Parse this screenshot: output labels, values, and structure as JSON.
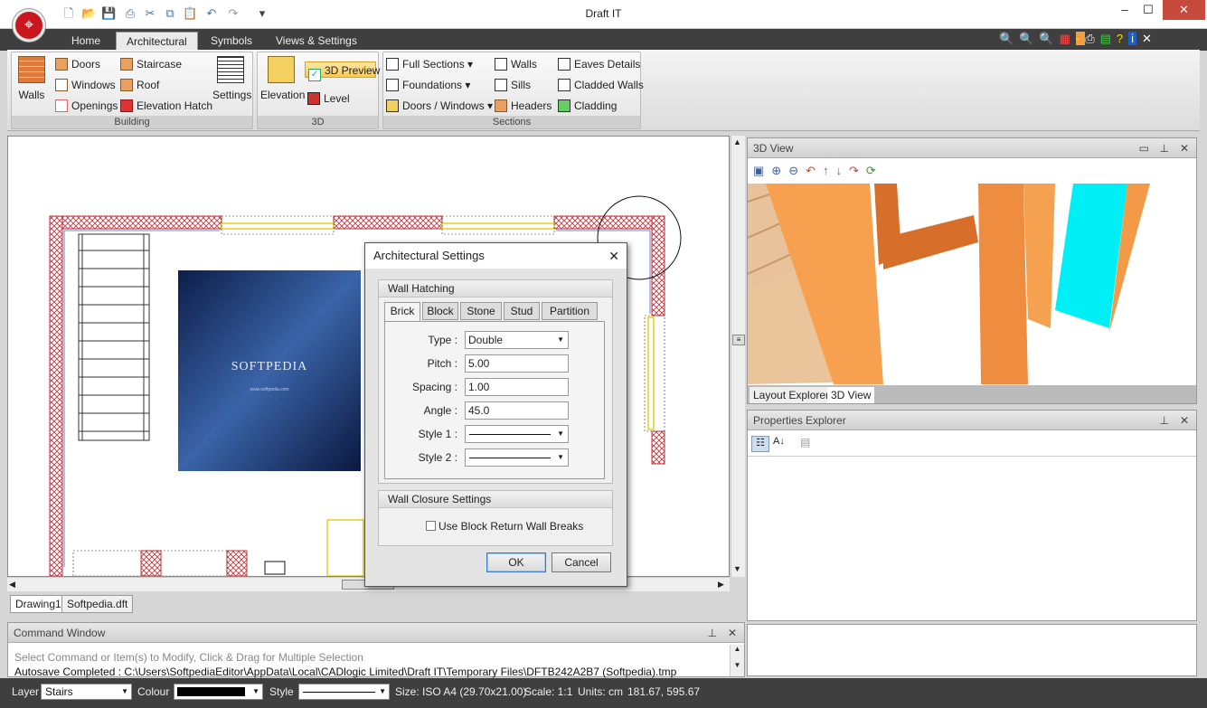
{
  "app": {
    "title": "Draft IT"
  },
  "ribbon_tabs": [
    "Home",
    "Architectural",
    "Symbols",
    "Views & Settings"
  ],
  "ribbon": {
    "building": {
      "caption": "Building",
      "walls": "Walls",
      "doors": "Doors",
      "windows": "Windows",
      "openings": "Openings",
      "staircase": "Staircase",
      "roof": "Roof",
      "elevation_hatch": "Elevation Hatch",
      "settings": "Settings"
    },
    "threed": {
      "caption": "3D",
      "elevation": "Elevation",
      "preview": "3D Preview",
      "level": "Level"
    },
    "sections": {
      "caption": "Sections",
      "full_sections": "Full Sections",
      "foundations": "Foundations",
      "doors_windows": "Doors / Windows",
      "walls": "Walls",
      "sills": "Sills",
      "headers": "Headers",
      "eaves": "Eaves Details",
      "cladded_walls": "Cladded Walls",
      "cladding": "Cladding"
    }
  },
  "canvas": {
    "watermark": "SOFTPEDIA",
    "watermark_url": "www.softpedia.com"
  },
  "doc_tabs": [
    "Drawing1",
    "Softpedia.dft"
  ],
  "command_window": {
    "title": "Command Window",
    "prompt": "Select Command or Item(s) to Modify, Click & Drag for Multiple Selection",
    "log": "Autosave Completed : C:\\Users\\SoftpediaEditor\\AppData\\Local\\CADlogic Limited\\Draft IT\\Temporary Files\\DFTB242A2B7 (Softpedia).tmp"
  },
  "view3d": {
    "title": "3D View",
    "tabs": [
      "Layout Explorer",
      "3D View"
    ]
  },
  "properties": {
    "title": "Properties Explorer"
  },
  "dialog": {
    "title": "Architectural Settings",
    "wall_hatching": "Wall Hatching",
    "tabs": [
      "Brick",
      "Block",
      "Stone",
      "Stud",
      "Partition"
    ],
    "fields": {
      "type_label": "Type :",
      "type_value": "Double",
      "pitch_label": "Pitch :",
      "pitch_value": "5.00",
      "spacing_label": "Spacing :",
      "spacing_value": "1.00",
      "angle_label": "Angle :",
      "angle_value": "45.0",
      "style1_label": "Style 1 :",
      "style2_label": "Style 2 :"
    },
    "wall_closure": "Wall Closure Settings",
    "checkbox_label": "Use Block Return Wall Breaks",
    "ok": "OK",
    "cancel": "Cancel"
  },
  "status": {
    "layer_label": "Layer",
    "layer_value": "Stairs",
    "colour_label": "Colour",
    "style_label": "Style",
    "size": "Size: ISO A4 (29.70x21.00)",
    "scale": "Scale: 1:1",
    "units": "Units: cm",
    "coords": "181.67, 595.67"
  },
  "colors": {
    "accent": "#c8181e",
    "dark": "#3f3f3f",
    "orange": "#f0954a",
    "cyan": "#00e8f0"
  }
}
